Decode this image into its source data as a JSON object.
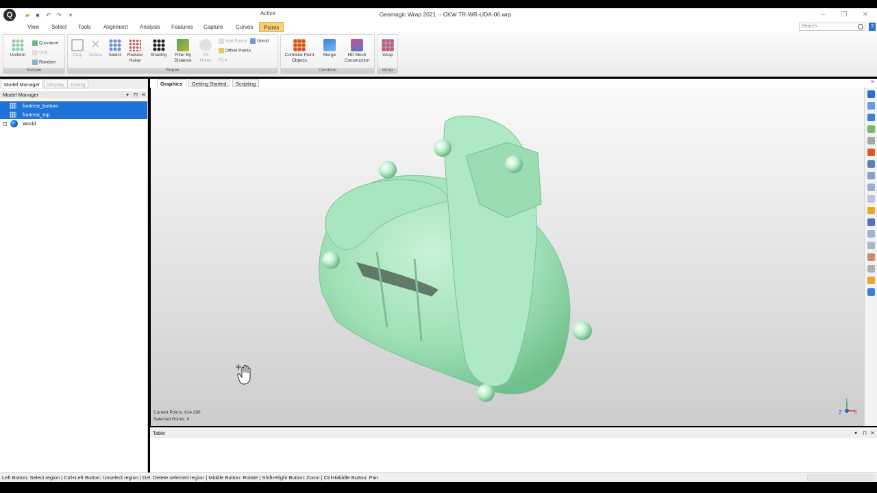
{
  "window": {
    "title": "Geomagic Wrap 2021 -- CKW TR-WR-UDA-06.wrp",
    "context_tab": "Active",
    "logo_letter": "Q"
  },
  "menu": {
    "items": [
      "View",
      "Select",
      "Tools",
      "Alignment",
      "Analysis",
      "Features",
      "Capture",
      "Curves",
      "Points"
    ],
    "active": "Points"
  },
  "search": {
    "placeholder": "Search"
  },
  "ribbon": {
    "sample": {
      "label": "Sample",
      "uniform": "Uniform",
      "curvature": "Curvature",
      "grid": "Grid",
      "random": "Random"
    },
    "repair": {
      "label": "Repair",
      "crop": "Crop",
      "delete": "Delete",
      "select": "Select",
      "reduce_noise": [
        "Reduce",
        "Noise"
      ],
      "shading": "Shading",
      "filter_by_distance": [
        "Filter By",
        "Distance"
      ],
      "fill_holes": [
        "Fill",
        "Holes"
      ],
      "fit": "Fit",
      "add_points": "Add Points",
      "offset_points": "Offset Points",
      "unroll": "Unroll"
    },
    "combine": {
      "label": "Combine",
      "combine_point_objects": [
        "Combine Point",
        "Objects"
      ],
      "merge": "Merge",
      "hd_mesh": [
        "HD Mesh",
        "Construction"
      ]
    },
    "wrap": {
      "label": "Wrap",
      "wrap": "Wrap"
    }
  },
  "left_panel": {
    "tabs": [
      "Model Manager",
      "Display",
      "Dialog"
    ],
    "active_tab": "Model Manager",
    "header": "Model Manager",
    "tree": [
      {
        "label": "footrest_bottom",
        "selected": true
      },
      {
        "label": "footrest_top",
        "selected": true
      },
      {
        "label": "World",
        "selected": false
      }
    ]
  },
  "doc_tabs": [
    "Graphics",
    "Getting Started",
    "Scripting"
  ],
  "viewport": {
    "current_points": "Current Points: 614,396",
    "selected_points": "Selected Points: 0",
    "model_color": "#9fe0b6"
  },
  "table_panel": {
    "title": "Table"
  },
  "status_bar": {
    "text": "Left Button: Select region | Ctrl+Left Button: Unselect region | Del: Delete selected region | Middle Button: Rotate | Shift+Right Button: Zoom | Ctrl+Middle Button: Pan"
  },
  "colors": {
    "accent": "#f7d27a",
    "selection": "#1f73d8",
    "model_green": "#9fe0b6"
  }
}
